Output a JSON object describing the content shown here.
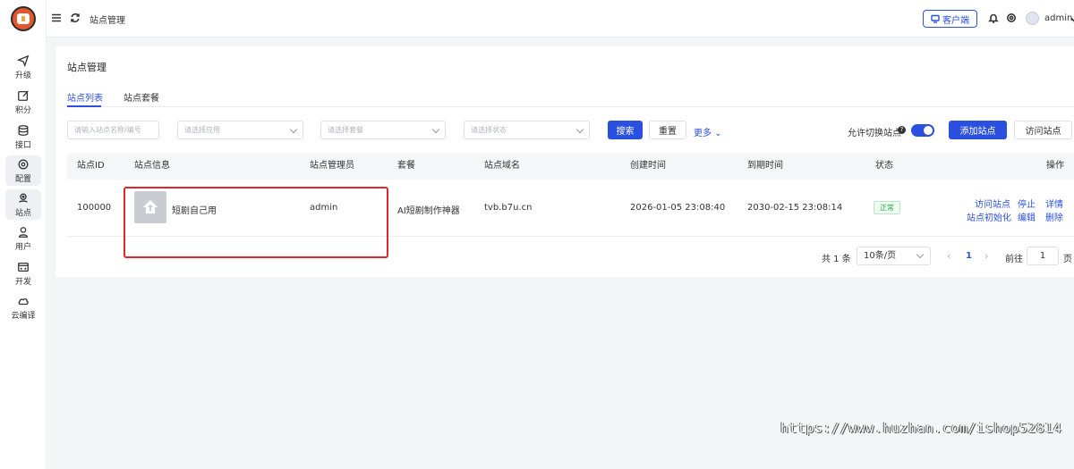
{
  "header": {
    "breadcrumb": "站点管理",
    "client_button": "客户端",
    "user_name": "admin"
  },
  "sidebar": {
    "items": [
      {
        "label": "升级",
        "icon": "send-icon"
      },
      {
        "label": "积分",
        "icon": "edit-icon"
      },
      {
        "label": "接口",
        "icon": "database-icon"
      },
      {
        "label": "配置",
        "icon": "settings-icon"
      },
      {
        "label": "站点",
        "icon": "location-icon"
      },
      {
        "label": "用户",
        "icon": "user-icon"
      },
      {
        "label": "开发",
        "icon": "code-window-icon"
      },
      {
        "label": "云编译",
        "icon": "cloud-icon"
      }
    ]
  },
  "page": {
    "title": "站点管理",
    "tabs": [
      {
        "label": "站点列表",
        "active": true
      },
      {
        "label": "站点套餐",
        "active": false
      }
    ]
  },
  "filters": {
    "search_placeholder": "请输入站点名称/编号",
    "app_placeholder": "请选择应用",
    "package_placeholder": "请选择套餐",
    "status_placeholder": "请选择状态",
    "search_button": "搜索",
    "reset_button": "重置",
    "more_button": "更多",
    "switch_label": "允许切换站点",
    "switch_on": true,
    "add_button": "添加站点",
    "visit_button": "访问站点"
  },
  "table": {
    "columns": [
      "站点ID",
      "站点信息",
      "站点管理员",
      "套餐",
      "站点域名",
      "创建时间",
      "到期时间",
      "状态",
      "操作"
    ],
    "rows": [
      {
        "id": "100000",
        "name": "短剧自己用",
        "admin": "admin",
        "package": "AI短剧制作神器",
        "domain": "tvb.b7u.cn",
        "created": "2026-01-05 23:08:40",
        "expires": "2030-02-15 23:08:14",
        "status": "正常",
        "actions": [
          "访问站点",
          "停止",
          "详情",
          "站点初始化",
          "编辑",
          "删除"
        ]
      }
    ]
  },
  "pagination": {
    "total": "共 1 条",
    "page_size": "10条/页",
    "current_page": "1",
    "goto_label": "前往",
    "goto_value": "1",
    "page_suffix": "页"
  },
  "watermark": "https://www.huzhan.com/ishop52814",
  "colors": {
    "primary": "#2b50e0",
    "success": "#2fa84f",
    "highlight": "#e0272b"
  }
}
